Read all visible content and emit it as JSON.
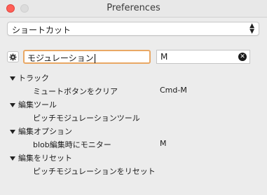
{
  "window": {
    "title": "Preferences"
  },
  "category_select": {
    "value": "ショートカット"
  },
  "search": {
    "value": "モジュレーション"
  },
  "key_filter": {
    "value": "M"
  },
  "groups": [
    {
      "label": "トラック",
      "items": [
        {
          "label": "ミュートボタンをクリア",
          "shortcut": "Cmd-M"
        }
      ]
    },
    {
      "label": "編集ツール",
      "items": [
        {
          "label": "ピッチモジュレーションツール",
          "shortcut": ""
        }
      ]
    },
    {
      "label": "編集オプション",
      "items": [
        {
          "label": "blob編集時にモニター",
          "shortcut": "M"
        }
      ]
    },
    {
      "label": "編集をリセット",
      "items": [
        {
          "label": "ピッチモジュレーションをリセット",
          "shortcut": ""
        }
      ]
    }
  ]
}
